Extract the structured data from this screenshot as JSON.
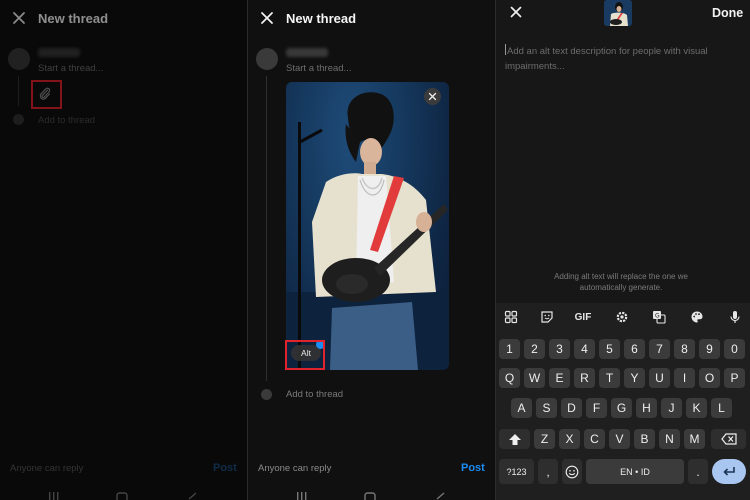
{
  "panel1": {
    "header_title": "New thread",
    "start_placeholder": "Start a thread...",
    "add_to_thread": "Add to thread",
    "reply_setting": "Anyone can reply",
    "post_label": "Post"
  },
  "panel2": {
    "header_title": "New thread",
    "start_placeholder": "Start a thread...",
    "alt_button": "Alt",
    "add_to_thread": "Add to thread",
    "reply_setting": "Anyone can reply",
    "post_label": "Post"
  },
  "panel3": {
    "done_label": "Done",
    "alt_placeholder": "Add an alt text description for people with visual impairments...",
    "replace_note": "Adding alt text will replace the one we automatically generate.",
    "keyboard": {
      "toolbar": [
        "apps-grid-icon",
        "sticker-icon",
        "GIF",
        "settings-icon",
        "translate-icon",
        "palette-icon",
        "mic-icon"
      ],
      "row_numbers": [
        "1",
        "2",
        "3",
        "4",
        "5",
        "6",
        "7",
        "8",
        "9",
        "0"
      ],
      "row1": [
        "Q",
        "W",
        "E",
        "R",
        "T",
        "Y",
        "U",
        "I",
        "O",
        "P"
      ],
      "row2": [
        "A",
        "S",
        "D",
        "F",
        "G",
        "H",
        "J",
        "K",
        "L"
      ],
      "row3": [
        "Z",
        "X",
        "C",
        "V",
        "B",
        "N",
        "M"
      ],
      "symbols_label": "?123",
      "comma": ",",
      "space_label": "EN • ID",
      "period": "."
    }
  },
  "colors": {
    "background": "#101010",
    "accent_blue": "#1d8cf0",
    "highlight_red": "#e0232c",
    "enter_key": "#a9c6f0"
  }
}
